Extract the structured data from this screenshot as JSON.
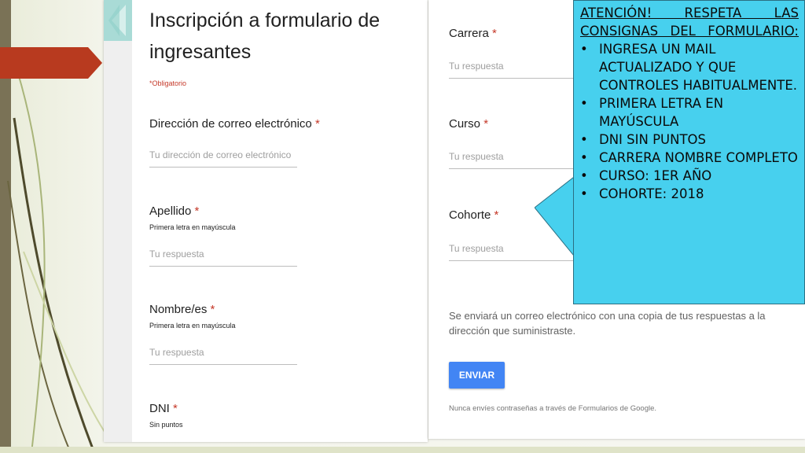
{
  "form": {
    "title": "Inscripción a formulario de ingresantes",
    "required_note": "*Obligatorio",
    "required_mark": "*",
    "fields_left": [
      {
        "label": "Dirección de correo electrónico",
        "hint": "",
        "placeholder": "Tu dirección de correo electrónico"
      },
      {
        "label": "Apellido",
        "hint": "Primera letra en mayúscula",
        "placeholder": "Tu respuesta"
      },
      {
        "label": "Nombre/es",
        "hint": "Primera letra en mayúscula",
        "placeholder": "Tu respuesta"
      },
      {
        "label": "DNI",
        "hint": "Sin puntos",
        "placeholder": ""
      }
    ],
    "fields_right": [
      {
        "label": "Carrera",
        "placeholder": "Tu respuesta"
      },
      {
        "label": "Curso",
        "placeholder": "Tu respuesta"
      },
      {
        "label": "Cohorte",
        "placeholder": "Tu respuesta"
      }
    ],
    "copy_note": "Se enviará un correo electrónico con una copia de tus respuestas a la dirección que suministraste.",
    "submit_label": "ENVIAR",
    "password_warning": "Nunca envíes contraseñas a través de Formularios de Google."
  },
  "callout": {
    "heading": "ATENCIÓN! RESPETA LAS CONSIGNAS DEL FORMULARIO:",
    "bullet_glyph": "•",
    "items": [
      "INGRESA UN MAIL ACTUALIZADO Y QUE CONTROLES HABITUALMENTE.",
      "PRIMERA LETRA EN MAYÚSCULA",
      "DNI SIN PUNTOS",
      "CARRERA NOMBRE COMPLETO",
      "CURSO: 1ER AÑO",
      "COHORTE: 2018"
    ]
  },
  "colors": {
    "callout_bg": "#47d0ee",
    "submit_button": "#4285f4",
    "required_red": "#c53929",
    "header_teal": "#a9dbd6",
    "slide_arrow_red": "#b83a1f"
  }
}
